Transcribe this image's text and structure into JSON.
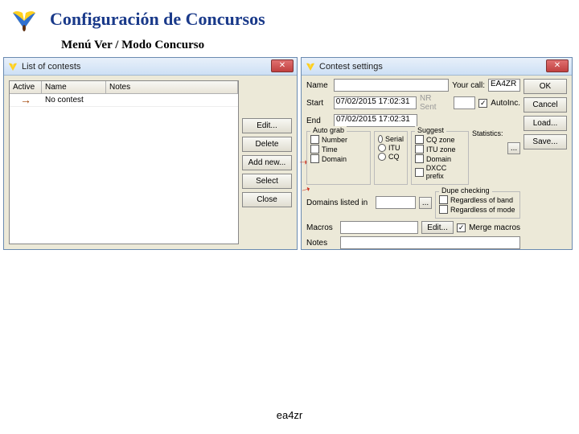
{
  "header": {
    "title": "Configuración de Concursos",
    "subtitle": "Menú Ver  /  Modo Concurso"
  },
  "list_window": {
    "title": "List of contests",
    "columns": [
      "Active",
      "Name",
      "Notes"
    ],
    "rows": [
      {
        "active_marker": "→",
        "name": "No contest",
        "notes": ""
      }
    ],
    "buttons": {
      "edit": "Edit...",
      "delete": "Delete",
      "addnew": "Add new...",
      "select": "Select",
      "close": "Close"
    }
  },
  "settings_window": {
    "title": "Contest settings",
    "labels": {
      "name": "Name",
      "your_call": "Your call:",
      "start": "Start",
      "end": "End",
      "nr_sent": "NR Sent",
      "autoinc": "AutoInc.",
      "auto_grab": "Auto grab",
      "number": "Number",
      "time": "Time",
      "domain": "Domain",
      "serial": "Serial",
      "itu": "ITU",
      "cq": "CQ",
      "suggest": "Suggest",
      "cq_zone": "CQ zone",
      "itu_zone": "ITU zone",
      "s_domain": "Domain",
      "dxcc": "DXCC prefix",
      "statistics": "Statistics:",
      "dupe_checking": "Dupe checking",
      "rob": "Regardless of band",
      "rom": "Regardless of mode",
      "domains_listed": "Domains listed in",
      "macros": "Macros",
      "merge_macros": "Merge macros",
      "edit_btn": "Edit...",
      "notes": "Notes"
    },
    "values": {
      "name": "",
      "your_call": "EA4ZR",
      "start": "07/02/2015 17:02:31",
      "end": "07/02/2015 17:02:31",
      "nr_sent": "",
      "autoinc_checked": "✓",
      "domains_listed": "",
      "macros": "",
      "notes": "",
      "merge_checked": "✓"
    },
    "buttons": {
      "ok": "OK",
      "cancel": "Cancel",
      "load": "Load...",
      "save": "Save...",
      "ellipsis": "..."
    }
  },
  "footer": "ea4zr"
}
